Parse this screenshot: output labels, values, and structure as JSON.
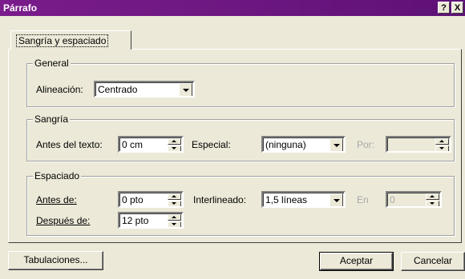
{
  "window": {
    "title": "Párrafo",
    "help_label": "?",
    "close_label": "X"
  },
  "tabs": [
    {
      "label": "Sangría y espaciado"
    }
  ],
  "general": {
    "legend": "General",
    "alignment_label": "Alineación:",
    "alignment_value": "Centrado"
  },
  "indent": {
    "legend": "Sangría",
    "before_label": "Antes del texto:",
    "before_value": "0 cm",
    "special_label": "Especial:",
    "special_value": "(ninguna)",
    "by_label": "Por:",
    "by_value": ""
  },
  "spacing": {
    "legend": "Espaciado",
    "before_label": "Antes de:",
    "before_value": "0 pto",
    "after_label": "Después de:",
    "after_value": "12 pto",
    "line_label": "Interlineado:",
    "line_value": "1,5 líneas",
    "at_label": "En",
    "at_value": "0"
  },
  "buttons": {
    "tabs_label": "Tabulaciones...",
    "ok_label": "Aceptar",
    "cancel_label": "Cancelar"
  }
}
